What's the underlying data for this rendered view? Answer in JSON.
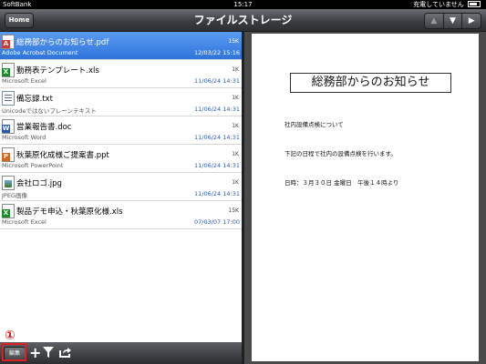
{
  "status_bar": {
    "carrier": "SoftBank",
    "time": "15:17",
    "battery_text": "充電していません"
  },
  "nav": {
    "home_label": "Home",
    "title": "ファイルストレージ",
    "arrow_up": "▲",
    "arrow_down": "▼",
    "arrow_right": "▶"
  },
  "files": [
    {
      "name": "総務部からのお知らせ.pdf",
      "app": "Adobe Acrobat Document",
      "size": "15K",
      "date": "12/03/22 15:16",
      "type": "pdf",
      "selected": true
    },
    {
      "name": "勤務表テンプレート.xls",
      "app": "Microsoft Excel",
      "size": "1K",
      "date": "11/06/24 14:31",
      "type": "xls"
    },
    {
      "name": "備忘録.txt",
      "app": "Unicodeではないプレーンテキスト",
      "size": "1K",
      "date": "11/06/24 14:31",
      "type": "txt"
    },
    {
      "name": "営業報告書.doc",
      "app": "Microsoft Word",
      "size": "1K",
      "date": "11/06/24 14:31",
      "type": "doc"
    },
    {
      "name": "秋葉原化成様ご提案書.ppt",
      "app": "Microsoft PowerPoint",
      "size": "1K",
      "date": "11/06/24 14:31",
      "type": "ppt"
    },
    {
      "name": "会社ロゴ.jpg",
      "app": "JPEG画像",
      "size": "1K",
      "date": "11/06/24 14:31",
      "type": "jpg"
    },
    {
      "name": "製品デモ申込・秋葉原化様.xls",
      "app": "Microsoft Excel",
      "size": "15K",
      "date": "07/03/07 17:00",
      "type": "xls"
    }
  ],
  "toolbar": {
    "edit_label": "編集",
    "add_icon": "+",
    "filter_icon": "filter",
    "export_icon": "export"
  },
  "annotation": {
    "marker": "①",
    "color": "#e02020"
  },
  "preview": {
    "title": "総務部からのお知らせ",
    "line1": "社内設備点検について",
    "line2": "下記の日程で社内の設備点検を行います。",
    "line3": "日時：３月３０日 金曜日　午後１４時より"
  },
  "colors": {
    "selection": "#2f74dc",
    "date_text": "#2e5bb5",
    "navbar": "#3b3e42"
  }
}
